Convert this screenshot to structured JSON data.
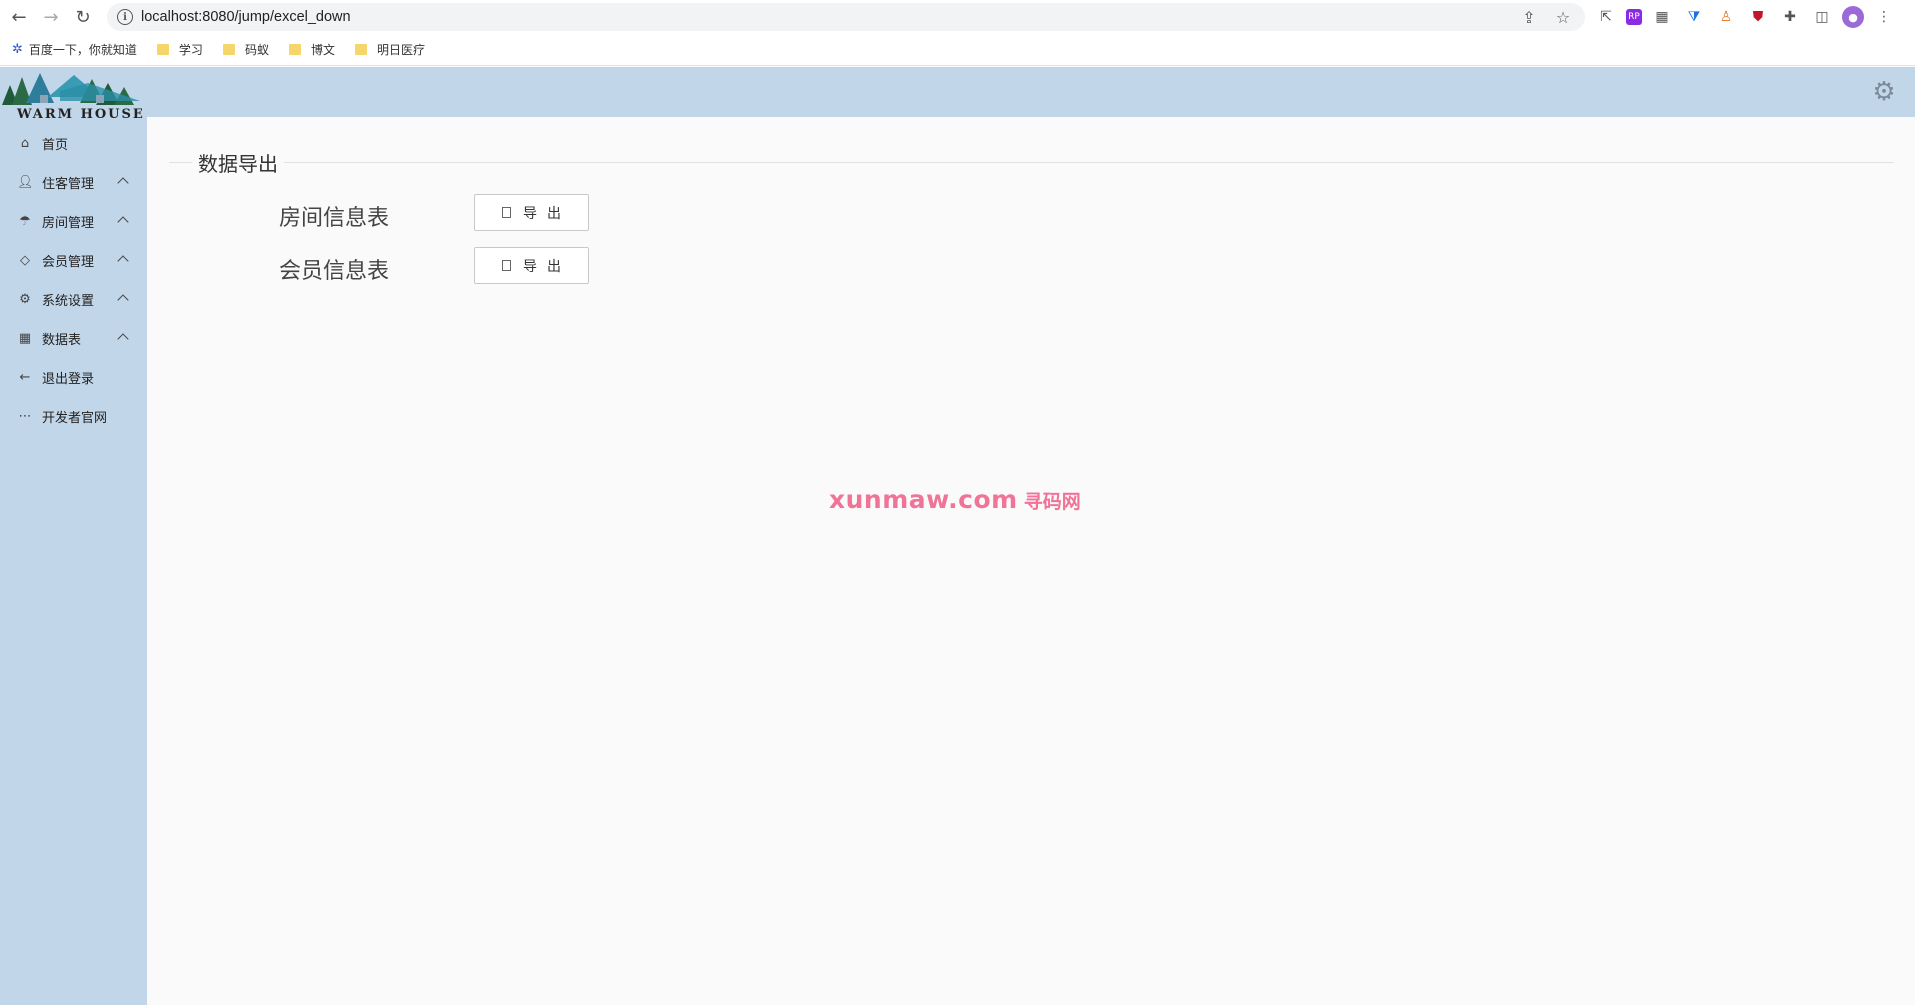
{
  "browser": {
    "url": "localhost:8080/jump/excel_down",
    "bookmarks": [
      {
        "label": "百度一下，你就知道",
        "type": "paw"
      },
      {
        "label": "学习",
        "type": "folder"
      },
      {
        "label": "码蚁",
        "type": "folder"
      },
      {
        "label": "博文",
        "type": "folder"
      },
      {
        "label": "明日医疗",
        "type": "folder"
      }
    ]
  },
  "app": {
    "logo_text": "WARM HOUSE",
    "menu": [
      {
        "label": "首页",
        "icon": "home-icon",
        "expandable": false
      },
      {
        "label": "住客管理",
        "icon": "user-icon",
        "expandable": true
      },
      {
        "label": "房间管理",
        "icon": "palm-icon",
        "expandable": true
      },
      {
        "label": "会员管理",
        "icon": "diamond-icon",
        "expandable": true
      },
      {
        "label": "系统设置",
        "icon": "gear-icon",
        "expandable": true
      },
      {
        "label": "数据表",
        "icon": "table-icon",
        "expandable": true
      },
      {
        "label": "退出登录",
        "icon": "arrow-left-icon",
        "expandable": false
      },
      {
        "label": "开发者官网",
        "icon": "more-icon",
        "expandable": false
      }
    ],
    "topbar_icon": "settings-gear-icon"
  },
  "main": {
    "section_title": "数据导出",
    "rows": [
      {
        "label": "房间信息表",
        "button": "导出"
      },
      {
        "label": "会员信息表",
        "button": "导出"
      }
    ]
  },
  "watermark": {
    "main": "xunmaw.com",
    "sub": "寻码网"
  },
  "colors": {
    "sidebar": "#c2d6ea",
    "content_bg": "#fafafb",
    "watermark": "#ef5d86"
  }
}
